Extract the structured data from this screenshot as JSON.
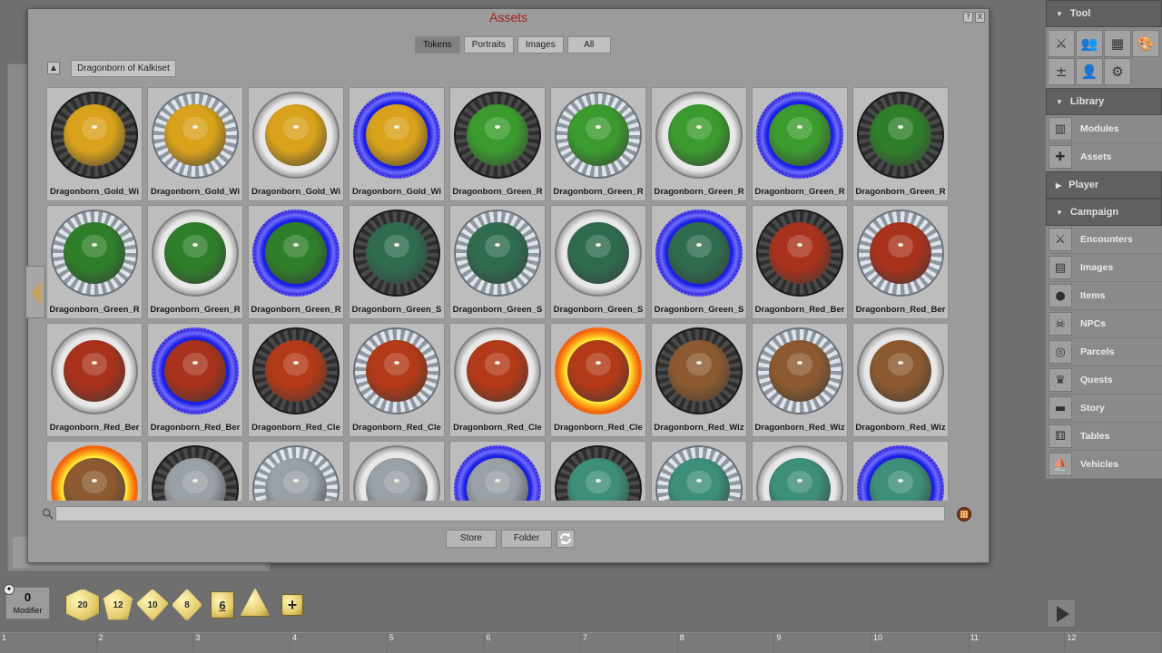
{
  "window": {
    "title": "Assets",
    "help_icon": "?",
    "close_icon": "X"
  },
  "tabs": [
    {
      "label": "Tokens",
      "active": true
    },
    {
      "label": "Portraits",
      "active": false
    },
    {
      "label": "Images",
      "active": false
    },
    {
      "label": "All",
      "active": false
    }
  ],
  "folder": "Dragonborn of Kalkiset",
  "tokens": [
    {
      "name": "Dragonborn_Gold_Wi",
      "rim": "black",
      "color": "#d9a21c"
    },
    {
      "name": "Dragonborn_Gold_Wi",
      "rim": "silver",
      "color": "#d9a21c"
    },
    {
      "name": "Dragonborn_Gold_Wi",
      "rim": "plain",
      "color": "#d9a21c"
    },
    {
      "name": "Dragonborn_Gold_Wi",
      "rim": "blue",
      "color": "#d9a21c"
    },
    {
      "name": "Dragonborn_Green_R",
      "rim": "black",
      "color": "#3b9b2e"
    },
    {
      "name": "Dragonborn_Green_R",
      "rim": "silver",
      "color": "#3b9b2e"
    },
    {
      "name": "Dragonborn_Green_R",
      "rim": "plain",
      "color": "#3b9b2e"
    },
    {
      "name": "Dragonborn_Green_R",
      "rim": "blue",
      "color": "#3b9b2e"
    },
    {
      "name": "Dragonborn_Green_R",
      "rim": "black",
      "color": "#2f7f2a"
    },
    {
      "name": "Dragonborn_Green_R",
      "rim": "silver",
      "color": "#2f7f2a"
    },
    {
      "name": "Dragonborn_Green_R",
      "rim": "plain",
      "color": "#2f7f2a"
    },
    {
      "name": "Dragonborn_Green_R",
      "rim": "blue",
      "color": "#2f7f2a"
    },
    {
      "name": "Dragonborn_Green_S",
      "rim": "black",
      "color": "#2f6b4f"
    },
    {
      "name": "Dragonborn_Green_S",
      "rim": "silver",
      "color": "#2f6b4f"
    },
    {
      "name": "Dragonborn_Green_S",
      "rim": "plain",
      "color": "#2f6b4f"
    },
    {
      "name": "Dragonborn_Green_S",
      "rim": "blue",
      "color": "#2f6b4f"
    },
    {
      "name": "Dragonborn_Red_Ber",
      "rim": "black",
      "color": "#a8321c"
    },
    {
      "name": "Dragonborn_Red_Ber",
      "rim": "silver",
      "color": "#a8321c"
    },
    {
      "name": "Dragonborn_Red_Ber",
      "rim": "plain",
      "color": "#a8321c"
    },
    {
      "name": "Dragonborn_Red_Ber",
      "rim": "blue",
      "color": "#a8321c"
    },
    {
      "name": "Dragonborn_Red_Cle",
      "rim": "black",
      "color": "#b23a18"
    },
    {
      "name": "Dragonborn_Red_Cle",
      "rim": "silver",
      "color": "#b23a18"
    },
    {
      "name": "Dragonborn_Red_Cle",
      "rim": "plain",
      "color": "#b23a18"
    },
    {
      "name": "Dragonborn_Red_Cle",
      "rim": "fire",
      "color": "#b23a18"
    },
    {
      "name": "Dragonborn_Red_Wiz",
      "rim": "black",
      "color": "#8c5a30"
    },
    {
      "name": "Dragonborn_Red_Wiz",
      "rim": "silver",
      "color": "#8c5a30"
    },
    {
      "name": "Dragonborn_Red_Wiz",
      "rim": "plain",
      "color": "#8c5a30"
    },
    {
      "name": "",
      "rim": "fire",
      "color": "#8c5a30"
    },
    {
      "name": "",
      "rim": "black",
      "color": "#9aa0a8"
    },
    {
      "name": "",
      "rim": "silver",
      "color": "#9aa0a8"
    },
    {
      "name": "",
      "rim": "plain",
      "color": "#9aa0a8"
    },
    {
      "name": "",
      "rim": "blue",
      "color": "#9aa0a8"
    },
    {
      "name": "",
      "rim": "black",
      "color": "#3d8f7a"
    },
    {
      "name": "",
      "rim": "silver",
      "color": "#3d8f7a"
    },
    {
      "name": "",
      "rim": "plain",
      "color": "#3d8f7a"
    },
    {
      "name": "",
      "rim": "blue",
      "color": "#3d8f7a"
    }
  ],
  "search": {
    "value": "",
    "placeholder": ""
  },
  "buttons": {
    "store": "Store",
    "folder": "Folder"
  },
  "sidebar": {
    "tool_header": "Tool",
    "tool_icons": [
      "crossed-swords-icon",
      "party-icon",
      "calendar-icon",
      "palette-icon",
      "modifier-icon",
      "players-icon",
      "gear-icon"
    ],
    "library_header": "Library",
    "library_items": [
      {
        "label": "Modules",
        "icon": "books-icon"
      },
      {
        "label": "Assets",
        "icon": "puzzle-icon"
      }
    ],
    "player_header": "Player",
    "campaign_header": "Campaign",
    "campaign_items": [
      {
        "label": "Encounters",
        "icon": "crossed-swords-icon"
      },
      {
        "label": "Images",
        "icon": "map-icon"
      },
      {
        "label": "Items",
        "icon": "bag-icon"
      },
      {
        "label": "NPCs",
        "icon": "skull-icon"
      },
      {
        "label": "Parcels",
        "icon": "coins-icon"
      },
      {
        "label": "Quests",
        "icon": "trophy-icon"
      },
      {
        "label": "Story",
        "icon": "book-icon"
      },
      {
        "label": "Tables",
        "icon": "dice-icon"
      },
      {
        "label": "Vehicles",
        "icon": "ship-icon"
      }
    ]
  },
  "dice_tray": {
    "modifier_value": "0",
    "modifier_label": "Modifier",
    "dice": [
      "20",
      "12",
      "10",
      "8",
      "6",
      "4"
    ],
    "add_label": "+"
  },
  "hotbar": [
    "1",
    "2",
    "3",
    "4",
    "5",
    "6",
    "7",
    "8",
    "9",
    "10",
    "11",
    "12"
  ],
  "colors": {
    "title": "#a4231d",
    "accent_gold": "#e5cc6c"
  }
}
